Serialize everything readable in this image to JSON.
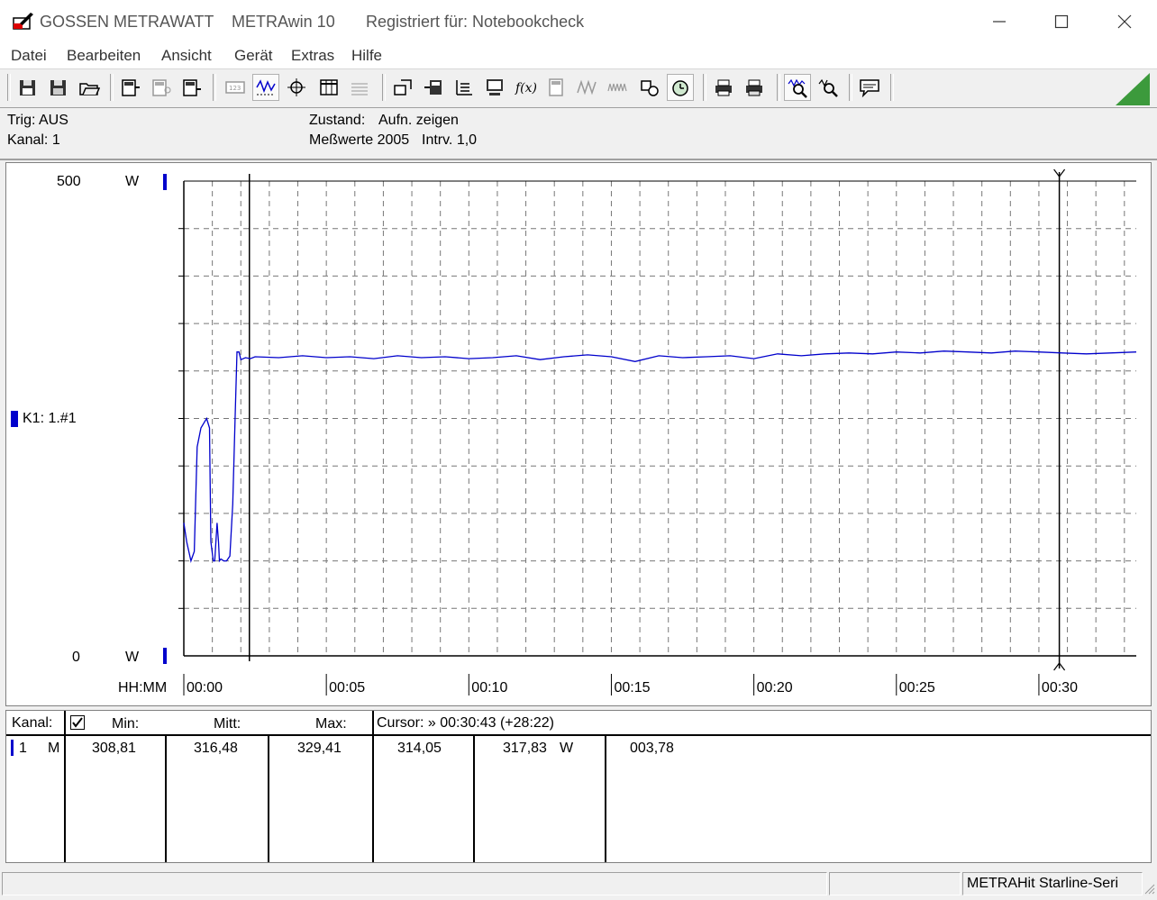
{
  "titlebar": {
    "app_name": "GOSSEN METRAWATT",
    "product": "METRAwin 10",
    "registered": "Registriert für: Notebookcheck"
  },
  "menu": [
    "Datei",
    "Bearbeiten",
    "Ansicht",
    "Gerät",
    "Extras",
    "Hilfe"
  ],
  "info": {
    "trig": "Trig: AUS",
    "kanal": "Kanal: 1",
    "zustand_label": "Zustand:",
    "zustand_value": "Aufn. zeigen",
    "messwerte": "Meßwerte 2005",
    "intrv": "Intrv. 1,0"
  },
  "chart": {
    "y_top": "500",
    "y_bottom": "0",
    "y_unit": "W",
    "x_unit": "HH:MM",
    "channel_label": "K1: 1.#1",
    "line_color": "#0000cc"
  },
  "chart_data": {
    "type": "line",
    "ylim": [
      0,
      500
    ],
    "xlim": [
      0,
      2005
    ],
    "x_tick_labels": [
      "00:00",
      "00:05",
      "00:10",
      "00:15",
      "00:20",
      "00:25",
      "00:30"
    ],
    "x_tick_values": [
      0,
      300,
      600,
      900,
      1200,
      1500,
      1800
    ],
    "cursor_left": 138,
    "cursor_right": 1843,
    "series": [
      {
        "name": "K1: 1.#1",
        "x": [
          0,
          6,
          15,
          22,
          28,
          36,
          42,
          48,
          54,
          57,
          62,
          65,
          70,
          73,
          75,
          78,
          84,
          90,
          97,
          103,
          108,
          112,
          116,
          120,
          130,
          140,
          150,
          200,
          250,
          300,
          350,
          400,
          450,
          500,
          550,
          600,
          650,
          700,
          750,
          800,
          850,
          900,
          950,
          1000,
          1050,
          1100,
          1150,
          1200,
          1250,
          1300,
          1350,
          1400,
          1450,
          1500,
          1550,
          1600,
          1650,
          1700,
          1750,
          1800,
          1850,
          1900,
          1950,
          2005
        ],
        "y": [
          140,
          120,
          100,
          110,
          220,
          240,
          245,
          250,
          240,
          120,
          100,
          100,
          140,
          120,
          100,
          102,
          100,
          100,
          105,
          160,
          250,
          320,
          320,
          312,
          314,
          313,
          315,
          314,
          316,
          314,
          315,
          313,
          316,
          314,
          315,
          313,
          314,
          316,
          312,
          315,
          317,
          315,
          310,
          316,
          314,
          315,
          316,
          313,
          318,
          316,
          318,
          319,
          318,
          320,
          319,
          321,
          320,
          319,
          321,
          320,
          319,
          318,
          319,
          320
        ]
      }
    ]
  },
  "table": {
    "h_kanal": "Kanal:",
    "h_min": "Min:",
    "h_mitt": "Mitt:",
    "h_max": "Max:",
    "h_cursor": "Cursor: » 00:30:43 (+28:22)",
    "r_channel": "1",
    "r_mode": "M",
    "r_min": "308,81",
    "r_mitt": "316,48",
    "r_max": "329,41",
    "r_c1": "314,05",
    "r_c2": "317,83",
    "r_unit": "W",
    "r_diff": "003,78"
  },
  "status": {
    "device": "METRAHit Starline-Seri"
  }
}
